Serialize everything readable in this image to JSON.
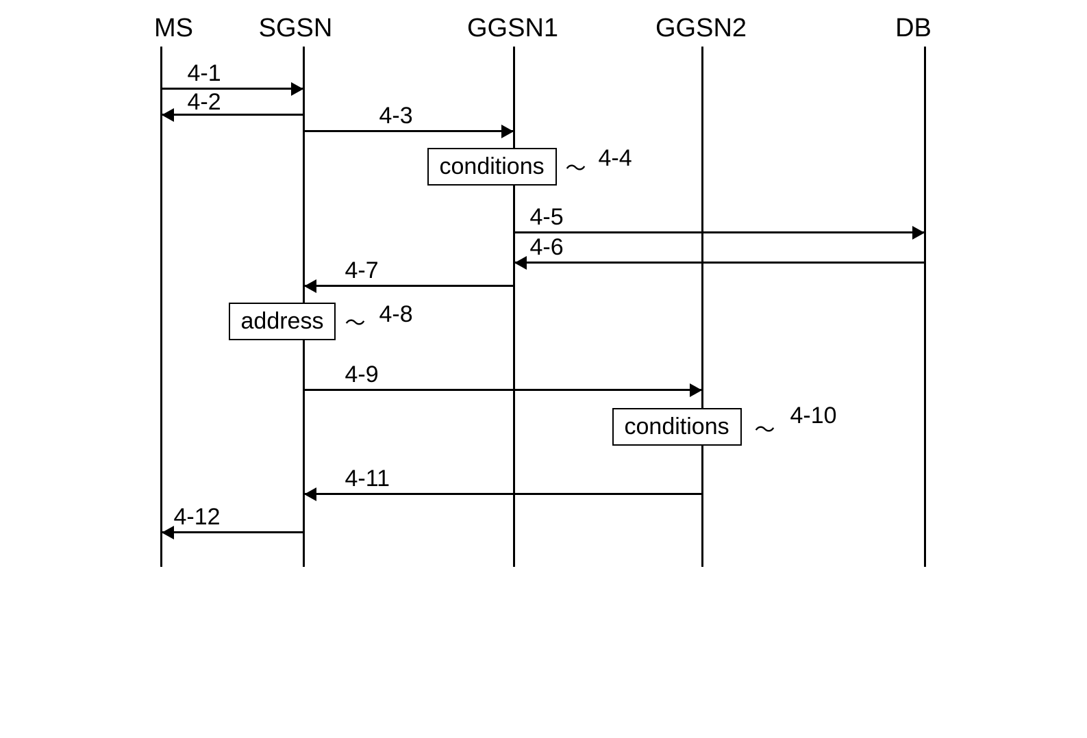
{
  "participants": {
    "ms": "MS",
    "sgsn": "SGSN",
    "ggsn1": "GGSN1",
    "ggsn2": "GGSN2",
    "db": "DB"
  },
  "messages": {
    "m4_1": "4-1",
    "m4_2": "4-2",
    "m4_3": "4-3",
    "m4_5": "4-5",
    "m4_6": "4-6",
    "m4_7": "4-7",
    "m4_9": "4-9",
    "m4_11": "4-11",
    "m4_12": "4-12"
  },
  "boxes": {
    "conditions1": {
      "label": "conditions",
      "tag": "4-4"
    },
    "address": {
      "label": "address",
      "tag": "4-8"
    },
    "conditions2": {
      "label": "conditions",
      "tag": "4-10"
    }
  },
  "lifeline_x": {
    "ms": 40,
    "sgsn": 248,
    "ggsn1": 555,
    "ggsn2": 830,
    "db": 1155
  }
}
